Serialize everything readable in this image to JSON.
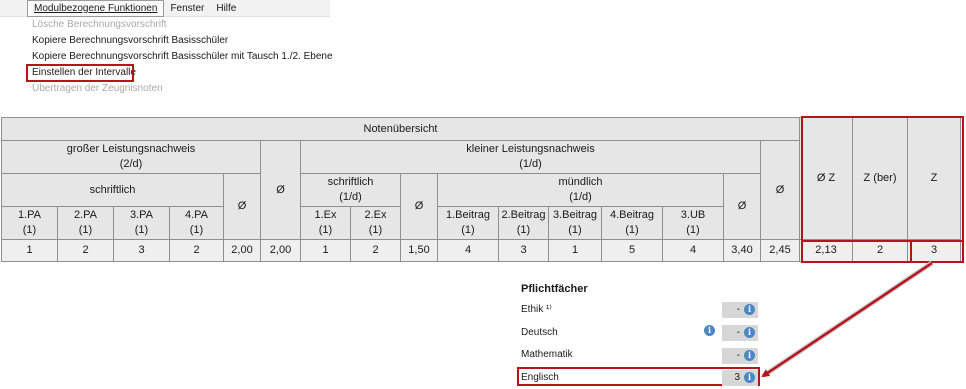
{
  "menu": {
    "items": [
      "Modulbezogene Funktionen",
      "Fenster",
      "Hilfe"
    ],
    "dropdown": [
      {
        "label": "Lösche Berechnungsvorschrift",
        "disabled": true
      },
      {
        "label": "Kopiere Berechnungsvorschrift Basisschüler",
        "disabled": false
      },
      {
        "label": "Kopiere Berechnungsvorschrift Basisschüler mit Tausch 1./2. Ebene",
        "disabled": false
      },
      {
        "label": "Einstellen der Intervalle",
        "disabled": false,
        "highlighted": true
      },
      {
        "label": "Übertragen der Zeugnisnoten",
        "disabled": true
      }
    ]
  },
  "table": {
    "title": "Notenübersicht",
    "gross": "großer Leistungsnachweis",
    "gross_sub": "(2/d)",
    "klein": "kleiner Leistungsnachweis",
    "klein_sub": "(1/d)",
    "schriftlich": "schriftlich",
    "schriftlich2_sub": "(1/d)",
    "muendlich": "mündlich",
    "muendlich_sub": "(1/d)",
    "avg": "Ø",
    "avg_z": "Ø Z",
    "z_ber": "Z (ber)",
    "z": "Z",
    "cols_gross": [
      {
        "name": "1.PA",
        "w": "(1)"
      },
      {
        "name": "2.PA",
        "w": "(1)"
      },
      {
        "name": "3.PA",
        "w": "(1)"
      },
      {
        "name": "4.PA",
        "w": "(1)"
      }
    ],
    "cols_ex": [
      {
        "name": "1.Ex",
        "w": "(1)"
      },
      {
        "name": "2.Ex",
        "w": "(1)"
      }
    ],
    "cols_muend": [
      {
        "name": "1.Beitrag",
        "w": "(1)"
      },
      {
        "name": "2.Beitrag",
        "w": "(1)"
      },
      {
        "name": "3.Beitrag",
        "w": "(1)"
      },
      {
        "name": "4.Beitrag",
        "w": "(1)"
      },
      {
        "name": "3.UB",
        "w": "(1)"
      }
    ],
    "row": [
      "1",
      "2",
      "3",
      "2",
      "2,00",
      "2,00",
      "1",
      "2",
      "1,50",
      "4",
      "3",
      "1",
      "5",
      "4",
      "3,40",
      "2,45",
      "2,13",
      "2",
      "3"
    ]
  },
  "panel": {
    "title": "Pflichtfächer",
    "subjects": [
      {
        "name": "Ethik ¹⁾",
        "value": "-",
        "has_info": false
      },
      {
        "name": "Deutsch",
        "value": "-",
        "has_info": true
      },
      {
        "name": "Mathematik",
        "value": "-",
        "has_info": false
      },
      {
        "name": "Englisch",
        "value": "3",
        "has_info": false
      }
    ],
    "info_glyph": "i"
  },
  "colors": {
    "highlight": "#b8121b",
    "info": "#4c86c6"
  }
}
